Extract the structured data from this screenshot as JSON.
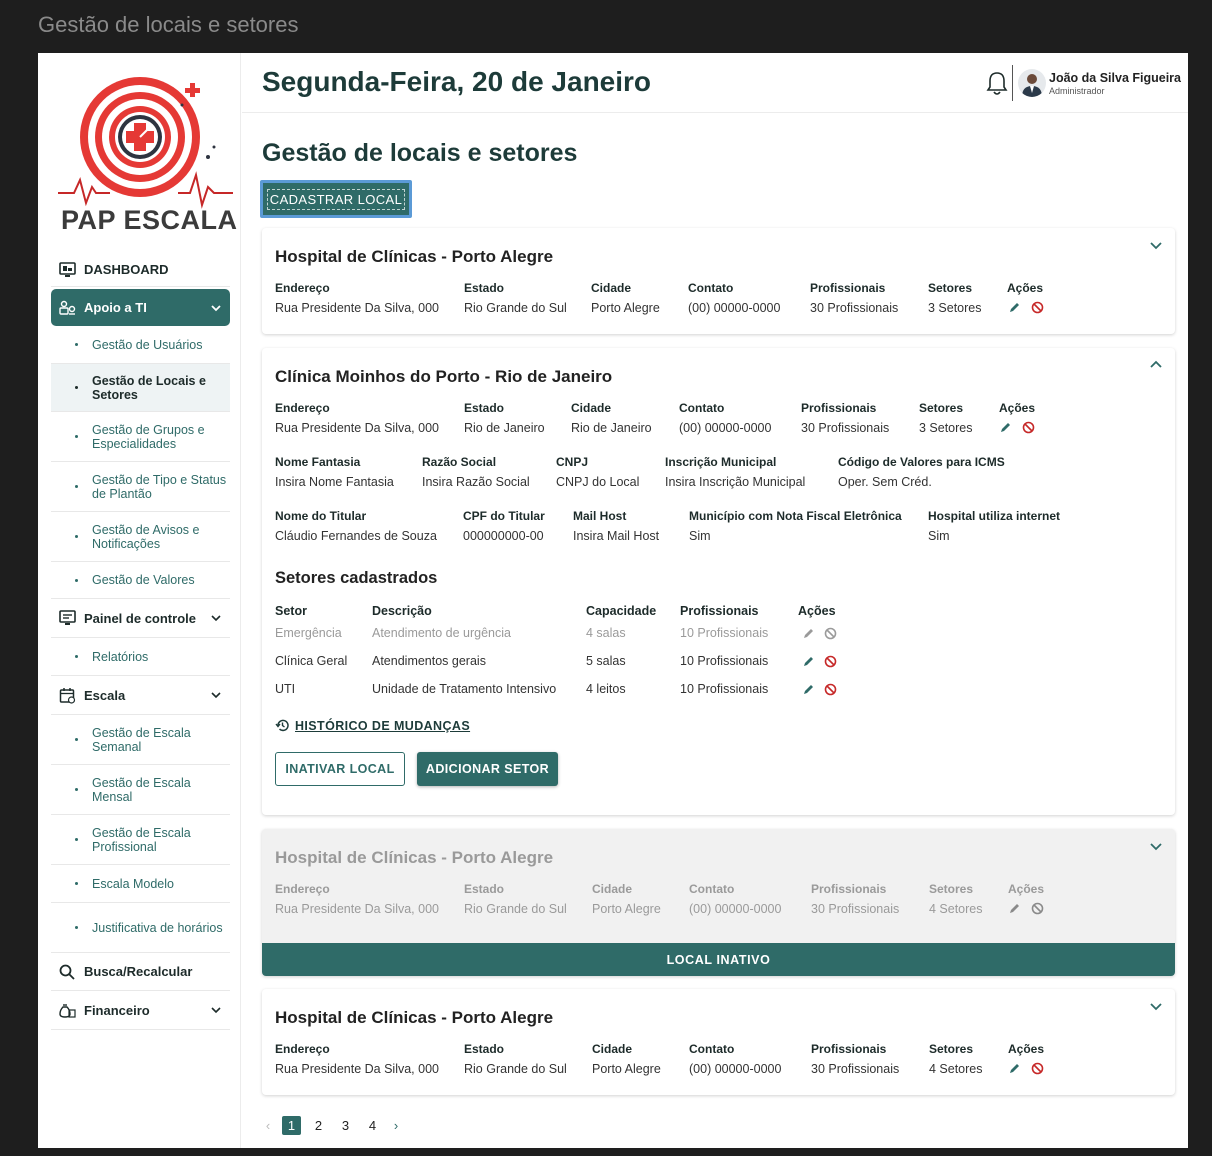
{
  "window_title": "Gestão de locais e setores",
  "brand": {
    "name": "PAP ESCALA"
  },
  "sidebar": {
    "dashboard": "DASHBOARD",
    "apoio": "Apoio a TI",
    "apoio_items": [
      "Gestão de Usuários",
      "Gestão de Locais e Setores",
      "Gestão de Grupos e Especialidades",
      "Gestão de Tipo e Status de Plantão",
      "Gestão de Avisos e Notificações",
      "Gestão de Valores"
    ],
    "painel": "Painel de controle",
    "painel_items": [
      "Relatórios"
    ],
    "escala": "Escala",
    "escala_items": [
      "Gestão de Escala Semanal",
      "Gestão de Escala Mensal",
      "Gestão de Escala Profissional",
      "Escala Modelo",
      "Justificativa de horários"
    ],
    "busca": "Busca/Recalcular",
    "financeiro": "Financeiro"
  },
  "header": {
    "date": "Segunda-Feira, 20 de Janeiro",
    "user_name": "João da Silva Figueira",
    "user_role": "Administrador"
  },
  "page": {
    "title": "Gestão de locais e setores",
    "register_button": "CADASTRAR LOCAL"
  },
  "labels": {
    "endereco": "Endereço",
    "estado": "Estado",
    "cidade": "Cidade",
    "contato": "Contato",
    "profissionais": "Profissionais",
    "setores": "Setores",
    "acoes": "Ações",
    "nome_fantasia": "Nome Fantasia",
    "razao_social": "Razão Social",
    "cnpj": "CNPJ",
    "inscricao": "Inscrição Municipal",
    "codigo_icms": "Código de Valores para ICMS",
    "nome_titular": "Nome do Titular",
    "cpf_titular": "CPF do Titular",
    "mail_host": "Mail Host",
    "municipio_nf": "Município com Nota Fiscal Eletrônica",
    "hospital_internet": "Hospital utiliza internet"
  },
  "cards": [
    {
      "title": "Hospital de Clínicas - Porto Alegre",
      "endereco": "Rua Presidente Da Silva, 000",
      "estado": "Rio Grande do Sul",
      "cidade": "Porto Alegre",
      "contato": "(00) 00000-0000",
      "profissionais": "30 Profissionais",
      "setores": "3 Setores"
    },
    {
      "title": "Clínica Moinhos do Porto - Rio de Janeiro",
      "endereco": "Rua Presidente Da Silva, 000",
      "estado": "Rio de Janeiro",
      "cidade": "Rio de Janeiro",
      "contato": "(00) 00000-0000",
      "profissionais": "30 Profissionais",
      "setores": "3 Setores",
      "nome_fantasia": "Insira Nome Fantasia",
      "razao_social": "Insira Razão Social",
      "cnpj": "CNPJ do Local",
      "inscricao": "Insira Inscrição Municipal",
      "codigo_icms": "Oper. Sem Créd.",
      "nome_titular": "Cláudio Fernandes de Souza",
      "cpf_titular": "000000000-00",
      "mail_host": "Insira Mail Host",
      "municipio_nf": "Sim",
      "hospital_internet": "Sim",
      "sectors_title": "Setores cadastrados",
      "sector_headers": [
        "Setor",
        "Descrição",
        "Capacidade",
        "Profissionais",
        "Ações"
      ],
      "sectors": [
        {
          "setor": "Emergência",
          "descricao": "Atendimento de urgência",
          "capacidade": "4 salas",
          "profissionais": "10 Profissionais",
          "disabled": true
        },
        {
          "setor": "Clínica Geral",
          "descricao": "Atendimentos gerais",
          "capacidade": "5 salas",
          "profissionais": "10 Profissionais",
          "disabled": false
        },
        {
          "setor": "UTI",
          "descricao": "Unidade de Tratamento Intensivo",
          "capacidade": "4 leitos",
          "profissionais": "10 Profissionais",
          "disabled": false
        }
      ],
      "history_link": "HISTÓRICO DE MUDANÇAS",
      "inactivate_button": "INATIVAR LOCAL",
      "add_sector_button": "ADICIONAR SETOR"
    },
    {
      "title": "Hospital de Clínicas - Porto Alegre",
      "endereco": "Rua Presidente Da Silva, 000",
      "estado": "Rio Grande do Sul",
      "cidade": "Porto Alegre",
      "contato": "(00) 00000-0000",
      "profissionais": "30 Profissionais",
      "setores": "4 Setores",
      "inactive_label": "LOCAL INATIVO"
    },
    {
      "title": "Hospital de Clínicas - Porto Alegre",
      "endereco": "Rua Presidente Da Silva, 000",
      "estado": "Rio Grande do Sul",
      "cidade": "Porto Alegre",
      "contato": "(00) 00000-0000",
      "profissionais": "30 Profissionais",
      "setores": "4 Setores"
    }
  ],
  "pagination": {
    "pages": [
      "1",
      "2",
      "3",
      "4"
    ],
    "current": "1",
    "prev": "‹",
    "next": "›"
  },
  "icons": {
    "edit": "pencil-icon",
    "delete": "block-icon",
    "history": "history-icon",
    "bell": "bell-icon"
  },
  "colors": {
    "primary": "#2f6b68",
    "danger": "#c62828",
    "title": "#1d3b39"
  }
}
